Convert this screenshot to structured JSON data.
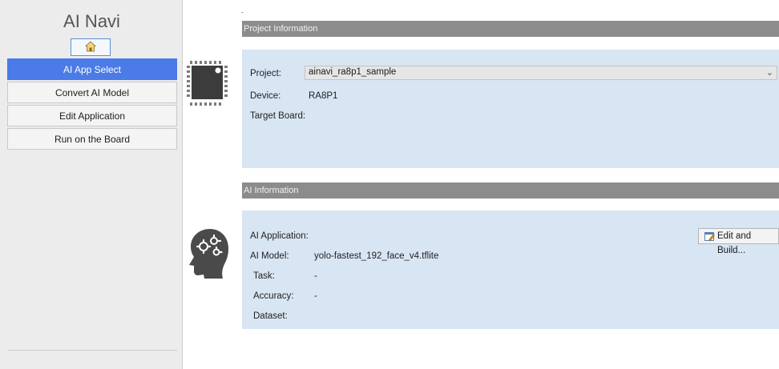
{
  "sidebar": {
    "title": "AI Navi",
    "home_icon": "home-icon",
    "items": [
      {
        "label": "AI App Select",
        "active": true
      },
      {
        "label": "Convert AI Model",
        "active": false
      },
      {
        "label": "Edit Application",
        "active": false
      },
      {
        "label": "Run on the Board",
        "active": false
      }
    ]
  },
  "project_info": {
    "header": "Project Information",
    "icon": "chip-icon",
    "project_label": "Project:",
    "project_value": "ainavi_ra8p1_sample",
    "device_label": "Device:",
    "device_value": "RA8P1",
    "target_board_label": "Target Board:"
  },
  "ai_info": {
    "header": "AI Information",
    "icon": "brain-gear-icon",
    "application_label": "AI Application:",
    "edit_build_label": "Edit and Build...",
    "model_label": "AI Model:",
    "model_value": "yolo-fastest_192_face_v4.tflite",
    "task_label": "Task:",
    "task_value": "-",
    "accuracy_label": "Accuracy:",
    "accuracy_value": "-",
    "dataset_label": "Dataset:"
  },
  "colors": {
    "active_nav": "#4a7be7",
    "section_header": "#8c8c8c",
    "panel_bg": "#d8e5f3"
  }
}
